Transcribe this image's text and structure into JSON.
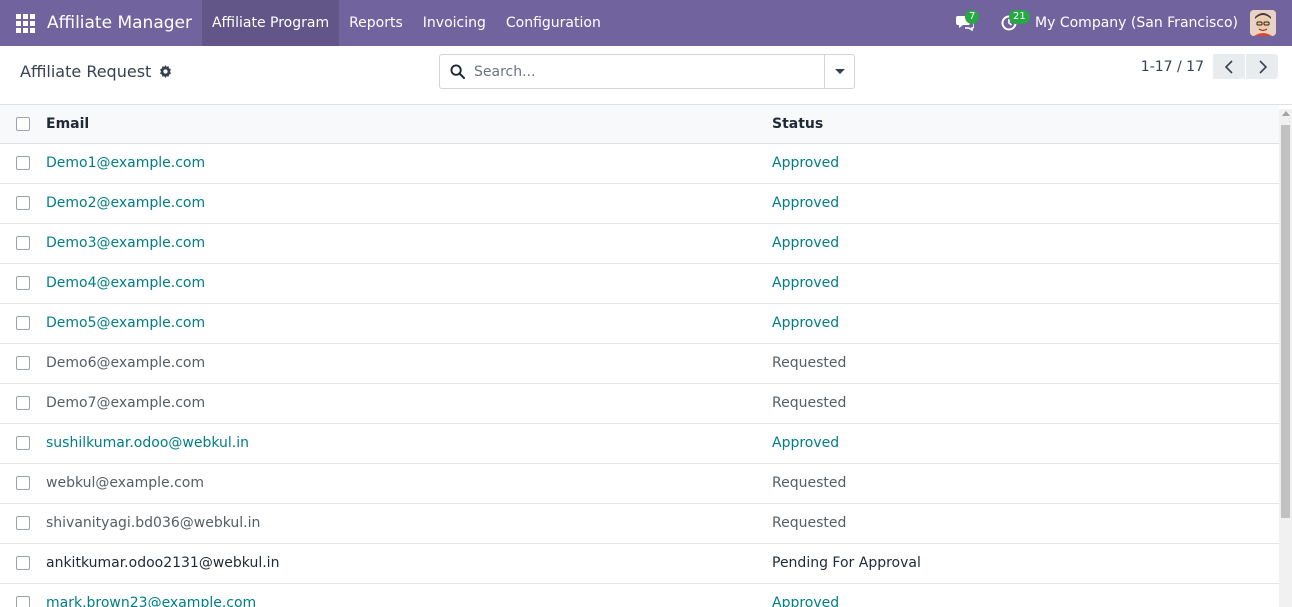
{
  "navbar": {
    "app_name": "Affiliate Manager",
    "menu": [
      "Affiliate Program",
      "Reports",
      "Invoicing",
      "Configuration"
    ],
    "active_menu": "Affiliate Program",
    "messages_count": "7",
    "activities_count": "21",
    "company": "My Company (San Francisco)",
    "accent_color": "#71639e"
  },
  "control_panel": {
    "title": "Affiliate Request",
    "search_placeholder": "Search...",
    "pager": "1-17 / 17"
  },
  "list": {
    "columns": [
      "Email",
      "Status"
    ],
    "rows": [
      {
        "email": "Demo1@example.com",
        "status": "Approved",
        "style": "link"
      },
      {
        "email": "Demo2@example.com",
        "status": "Approved",
        "style": "link"
      },
      {
        "email": "Demo3@example.com",
        "status": "Approved",
        "style": "link"
      },
      {
        "email": "Demo4@example.com",
        "status": "Approved",
        "style": "link"
      },
      {
        "email": "Demo5@example.com",
        "status": "Approved",
        "style": "link"
      },
      {
        "email": "Demo6@example.com",
        "status": "Requested",
        "style": "muted"
      },
      {
        "email": "Demo7@example.com",
        "status": "Requested",
        "style": "muted"
      },
      {
        "email": "sushilkumar.odoo@webkul.in",
        "status": "Approved",
        "style": "link"
      },
      {
        "email": "webkul@example.com",
        "status": "Requested",
        "style": "muted"
      },
      {
        "email": "shivanityagi.bd036@webkul.in",
        "status": "Requested",
        "style": "muted"
      },
      {
        "email": "ankitkumar.odoo2131@webkul.in",
        "status": "Pending For Approval",
        "style": "dark"
      },
      {
        "email": "mark.brown23@example.com",
        "status": "Approved",
        "style": "link"
      }
    ]
  }
}
